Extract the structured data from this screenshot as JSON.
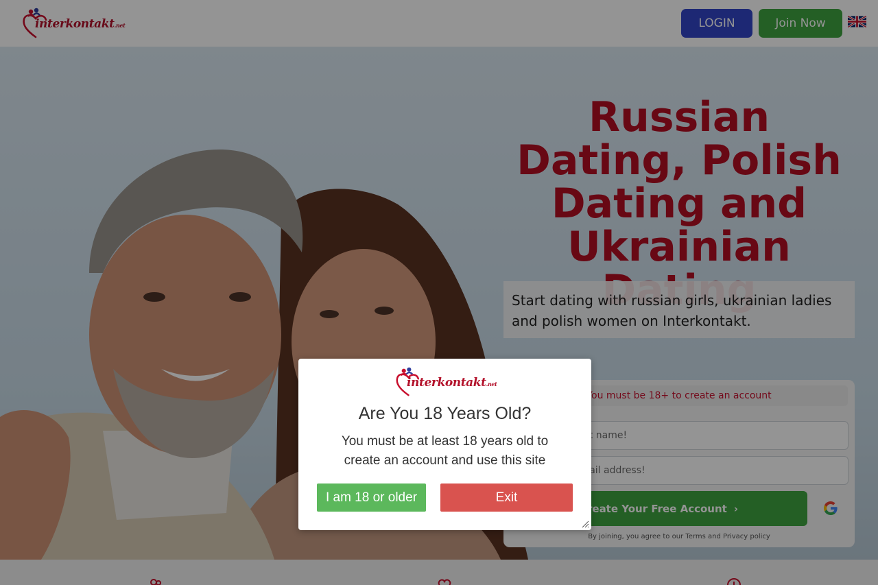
{
  "header": {
    "logo_text": "interkontakt",
    "logo_tld": ".net",
    "login_label": "LOGIN",
    "join_label": "Join Now",
    "language_flag": "uk-flag-icon"
  },
  "hero": {
    "headline": "Russian Dating, Polish Dating and Ukrainian Dating",
    "subtitle": "Start dating with russian girls, ukrainian ladies and polish women on Interkontakt."
  },
  "signup": {
    "warning": "You must be 18+ to create an account",
    "first_name_placeholder": "Enter your first name!",
    "email_placeholder": "Enter your email address!",
    "create_label": "Create Your Free Account",
    "create_arrow": "›",
    "terms": "By joining, you agree to our Terms and Privacy policy"
  },
  "age_modal": {
    "logo_text": "interkontakt",
    "logo_tld": ".net",
    "title": "Are You 18 Years Old?",
    "message": "You must be at least 18 years old to create an account and use this site",
    "confirm_label": "I am 18 or older",
    "exit_label": "Exit"
  },
  "colors": {
    "brand_red": "#b30f24",
    "login_blue": "#3346c8",
    "join_green": "#3ea441",
    "confirm_green": "#5cb85c",
    "exit_red": "#d9534f"
  }
}
